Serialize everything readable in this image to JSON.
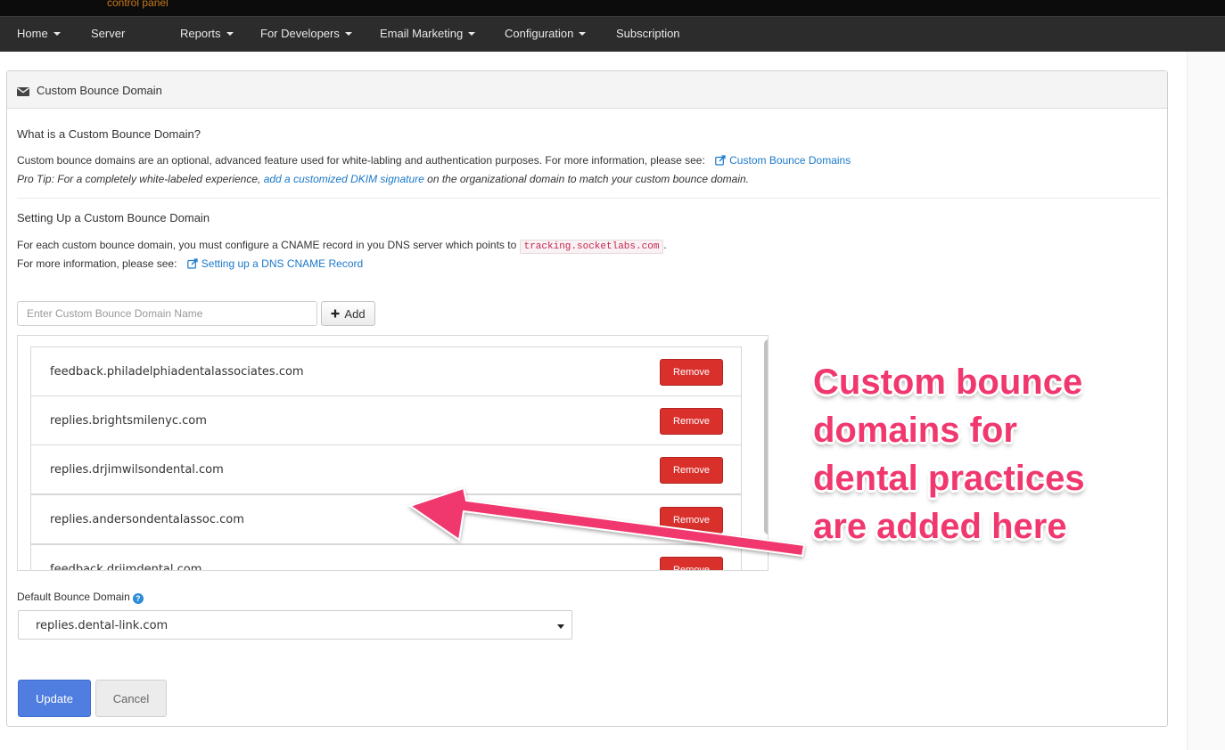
{
  "brand": {
    "subtitle": "control panel"
  },
  "nav": {
    "items": [
      {
        "label": "Home",
        "dropdown": true
      },
      {
        "label": "Server",
        "dropdown": false
      },
      {
        "label": "Reports",
        "dropdown": true
      },
      {
        "label": "For Developers",
        "dropdown": true
      },
      {
        "label": "Email Marketing",
        "dropdown": true
      },
      {
        "label": "Configuration",
        "dropdown": true
      },
      {
        "label": "Subscription",
        "dropdown": false
      }
    ]
  },
  "panel": {
    "icon": "envelope-icon",
    "title": "Custom Bounce Domain",
    "what_heading": "What is a Custom Bounce Domain?",
    "what_text": "Custom bounce domains are an optional, advanced feature used for white-labling and authentication purposes. For more information, please see:",
    "what_link": "Custom Bounce Domains",
    "protip_prefix": "Pro Tip: For a completely white-labeled experience,",
    "protip_link": "add a customized DKIM signature",
    "protip_suffix": "on the organizational domain to match your custom bounce domain.",
    "setup_heading": "Setting Up a Custom Bounce Domain",
    "setup_text": "For each custom bounce domain, you must configure a CNAME record in you DNS server which points to",
    "setup_code": "tracking.socketlabs.com",
    "setup_code_suffix": ".",
    "more_info_prefix": "For more information, please see:",
    "more_info_link": "Setting up a DNS CNAME Record"
  },
  "add_form": {
    "placeholder": "Enter Custom Bounce Domain Name",
    "value": "",
    "add_label": "Add"
  },
  "domains": [
    "feedback.philadelphiadentalassociates.com",
    "replies.brightsmilenyc.com",
    "replies.drjimwilsondental.com",
    "replies.andersondentalassoc.com",
    "feedback.drjimdental.com"
  ],
  "remove_label": "Remove",
  "default_bounce": {
    "label": "Default Bounce Domain",
    "help_icon": "question-circle-icon",
    "selected": "replies.dental-link.com"
  },
  "actions": {
    "update": "Update",
    "cancel": "Cancel"
  },
  "annotation": {
    "lines": [
      "Custom bounce",
      "domains for",
      "dental practices",
      "are added here"
    ],
    "color": "#f0386e"
  },
  "colors": {
    "accent": "#1b79c9",
    "danger": "#d9302c",
    "primary": "#4f7ee0"
  }
}
